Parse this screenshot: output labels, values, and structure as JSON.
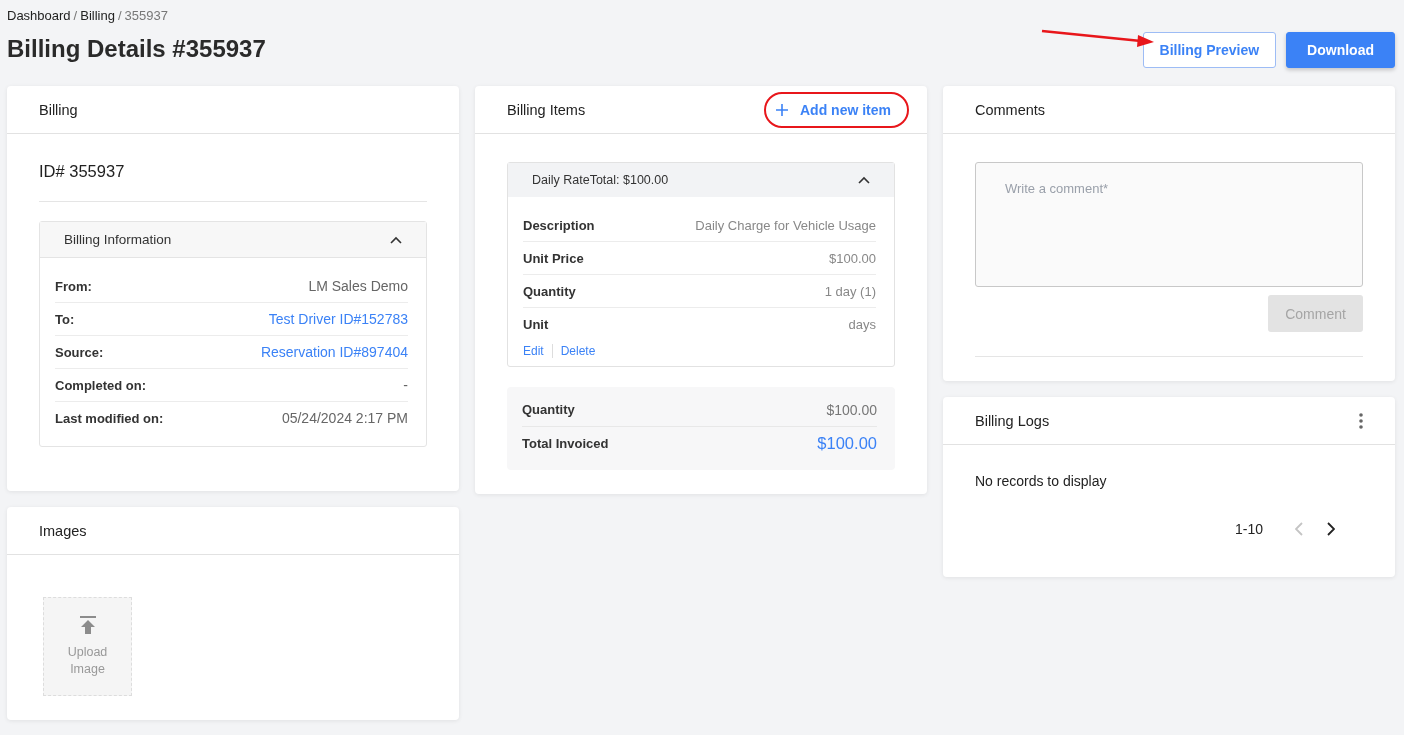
{
  "breadcrumb": [
    {
      "label": "Dashboard",
      "current": false
    },
    {
      "label": "Billing",
      "separator": "/",
      "current": false
    },
    {
      "label": "355937",
      "separator": "/",
      "current": true
    }
  ],
  "page_title": "Billing Details #355937",
  "header_buttons": [
    {
      "label": "Billing Preview",
      "kind": "outline"
    },
    {
      "label": "Download",
      "kind": "primary"
    }
  ],
  "billing_card": {
    "title": "Billing",
    "id_label": "ID# 355937",
    "info_panel": {
      "title": "Billing Information",
      "expanded": true,
      "rows": [
        {
          "label": "From:",
          "value": "LM Sales Demo",
          "kind": "text"
        },
        {
          "label": "To:",
          "value": "Test Driver ID#152783",
          "kind": "link"
        },
        {
          "label": "Source:",
          "value": "Reservation ID#897404",
          "kind": "link"
        },
        {
          "label": "Completed on:",
          "value": "-",
          "kind": "text"
        },
        {
          "label": "Last modified on:",
          "value": "05/24/2024 2:17 PM",
          "kind": "text"
        }
      ]
    }
  },
  "images_card": {
    "title": "Images",
    "upload_label": "Upload Image"
  },
  "items_card": {
    "title": "Billing Items",
    "add_button": "Add new item",
    "items": [
      {
        "header": "Daily RateTotal: $100.00",
        "expanded": true,
        "rows": [
          {
            "label": "Description",
            "value": "Daily Charge for Vehicle Usage"
          },
          {
            "label": "Unit Price",
            "value": "$100.00"
          },
          {
            "label": "Quantity",
            "value": "1 day (1)"
          },
          {
            "label": "Unit",
            "value": "days"
          }
        ],
        "actions": [
          "Edit",
          "Delete"
        ]
      }
    ],
    "summary": [
      {
        "label": "Quantity",
        "value": "$100.00",
        "kind": "plain"
      },
      {
        "label": "Total Invoiced",
        "value": "$100.00",
        "kind": "total"
      }
    ]
  },
  "comments_card": {
    "title": "Comments",
    "placeholder": "Write a comment*",
    "button": {
      "label": "Comment",
      "disabled": true
    }
  },
  "logs_card": {
    "title": "Billing Logs",
    "empty_text": "No records to display",
    "range": "1-10",
    "prev_disabled": true,
    "next_disabled": false
  }
}
